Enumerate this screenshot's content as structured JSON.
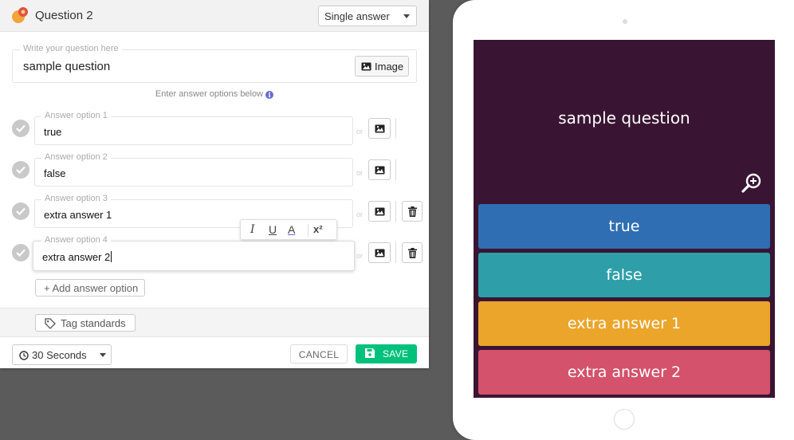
{
  "header": {
    "title": "Question 2",
    "question_type": "Single answer"
  },
  "question": {
    "legend": "Write your question here",
    "text": "sample question",
    "image_button_label": "Image"
  },
  "answers_hint": "Enter answer options below",
  "options": [
    {
      "legend": "Answer option 1",
      "text": "true",
      "or": "or",
      "deletable": false
    },
    {
      "legend": "Answer option 2",
      "text": "false",
      "or": "or",
      "deletable": false
    },
    {
      "legend": "Answer option 3",
      "text": "extra answer 1",
      "or": "or",
      "deletable": true
    },
    {
      "legend": "Answer option 4",
      "text": "extra answer 2",
      "or": "or",
      "deletable": true
    }
  ],
  "format_toolbar": {
    "italic": "I",
    "underline": "U",
    "color": "A",
    "superscript": "x²",
    "more": "···"
  },
  "add_option_label": "+ Add answer option",
  "tag_standards_label": "Tag standards",
  "footer": {
    "time_limit": "30 Seconds",
    "cancel_label": "CANCEL",
    "save_label": "SAVE"
  },
  "preview": {
    "question": "sample question",
    "answers": [
      "true",
      "false",
      "extra answer 1",
      "extra answer 2"
    ]
  },
  "colors": {
    "answer_1": "#2f6eb3",
    "answer_2": "#2e9fa8",
    "answer_3": "#eba52b",
    "answer_4": "#d4526b",
    "preview_background": "#3a1533",
    "save": "#00c17c"
  },
  "icons": {
    "logo": "quiz-logo-icon",
    "image": "image-icon",
    "check": "check-circle-icon",
    "trash": "trash-icon",
    "tag": "tag-icon",
    "clock": "clock-icon",
    "save": "floppy-icon",
    "zoom": "zoom-in-icon"
  }
}
